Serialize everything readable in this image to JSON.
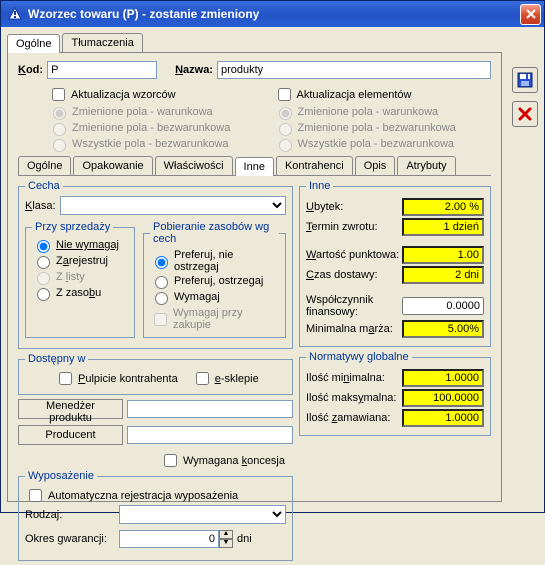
{
  "title": "Wzorzec towaru (P) - zostanie zmieniony",
  "tabs_top": {
    "ogolne": "Ogólne",
    "tlumaczenia": "Tłumaczenia"
  },
  "kod_label": "Kod:",
  "kod_value": "P",
  "nazwa_label": "Nazwa:",
  "nazwa_value": "produkty",
  "akt_wzorcow": "Aktualizacja wzorców",
  "akt_elem": "Aktualizacja elementów",
  "opt_warunkowa": "Zmienione pola - warunkowa",
  "opt_bezwarunkowa": "Zmienione pola - bezwarunkowa",
  "opt_wszystkie": "Wszystkie pola - bezwarunkowa",
  "tabs_mid": {
    "ogolne": "Ogólne",
    "opakowanie": "Opakowanie",
    "wlasciwosci": "Właściwości",
    "inne": "Inne",
    "kontrahenci": "Kontrahenci",
    "opis": "Opis",
    "atrybuty": "Atrybuty"
  },
  "cecha": {
    "legend": "Cecha",
    "klasa_label": "Klasa:",
    "przy_sprzedazy": "Przy sprzedaży",
    "nie_wymagaj": "Nie wymagaj",
    "zarejestruj": "Zarejestruj",
    "z_listy": "Z listy",
    "z_zasobu": "Z zasobu",
    "pobieranie": "Pobieranie zasobów wg cech",
    "preferuj_nie": "Preferuj, nie ostrzegaj",
    "preferuj_ost": "Preferuj, ostrzegaj",
    "wymagaj": "Wymagaj",
    "wymagaj_przy_zakupie": "Wymagaj przy zakupie"
  },
  "dostepny": {
    "legend": "Dostępny w",
    "pulpit": "Pulpicie kontrahenta",
    "esklep": "e-sklepie"
  },
  "menedzer": "Menedżer produktu",
  "producent": "Producent",
  "wymagana_koncesja": "Wymagana koncesja",
  "wyposazenie": {
    "legend": "Wyposażenie",
    "auto": "Automatyczna rejestracja wyposażenia",
    "rodzaj": "Rodzaj:",
    "okres": "Okres gwarancji:",
    "okres_val": "0",
    "dni": "dni"
  },
  "inne": {
    "legend": "Inne",
    "ubytek": "Ubytek:",
    "ubytek_v": "2.00 %",
    "termin": "Termin zwrotu:",
    "termin_v": "1 dzień",
    "wartosc": "Wartość punktowa:",
    "wartosc_v": "1.00",
    "czas": "Czas dostawy:",
    "czas_v": "2 dni",
    "wsp": "Współczynnik finansowy:",
    "wsp_v": "0.0000",
    "marza": "Minimalna marża:",
    "marza_v": "5.00%"
  },
  "norm": {
    "legend": "Normatywy globalne",
    "min": "Ilość minimalna:",
    "min_v": "1.0000",
    "max": "Ilość maksymalna:",
    "max_v": "100.0000",
    "zam": "Ilość zamawiana:",
    "zam_v": "1.0000"
  }
}
